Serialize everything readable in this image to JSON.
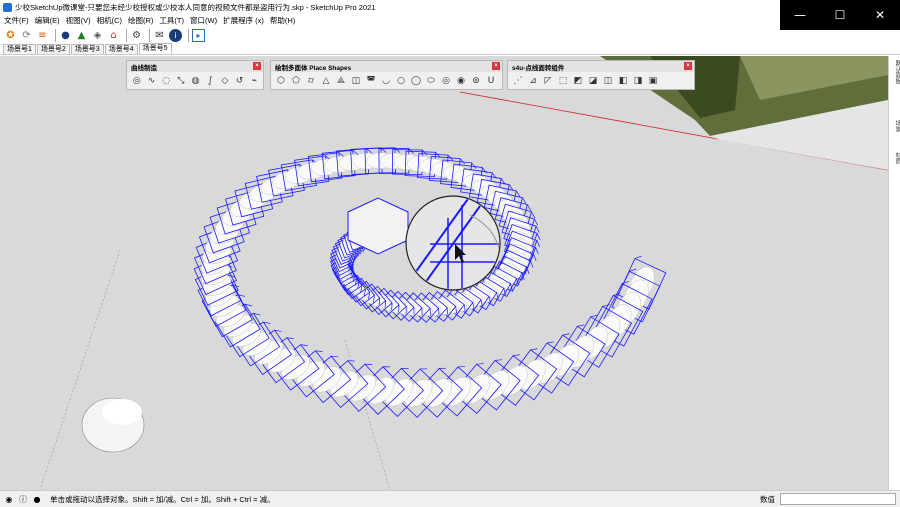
{
  "window": {
    "title": "少校SketchUp微课堂-只要您未经少校授权或少校本人同意的视频文件都是盗用行为.skp - SketchUp Pro 2021",
    "controls": {
      "minimize": "—",
      "maximize": "☐",
      "close": "✕"
    }
  },
  "menu": [
    "文件(F)",
    "编辑(E)",
    "视图(V)",
    "相机(C)",
    "绘图(R)",
    "工具(T)",
    "窗口(W)",
    "扩展程序 (x)",
    "帮助(H)"
  ],
  "toolbar": {
    "icons": [
      "getting-started-icon",
      "refresh-icon",
      "layers-icon",
      "components-icon",
      "tree-icon",
      "materials-icon",
      "warehouse-icon",
      "gear-icon",
      "mail-icon",
      "info-icon",
      "ruby-icon"
    ]
  },
  "scenes": {
    "tabs": [
      "场景号1",
      "场景号2",
      "场景号3",
      "场景号4",
      "场景号5"
    ],
    "active_index": 4
  },
  "panels": {
    "curve": {
      "title": "曲线制造",
      "close": "×"
    },
    "shapes": {
      "title": "绘制多面体 Place Shapes",
      "close": "×"
    },
    "s4u": {
      "title": "s4u-点线面转组件",
      "close": "×"
    }
  },
  "right_tray": [
    "默认面板",
    "场景",
    "材质"
  ],
  "status": {
    "message": "单击或拖动以选择对象。Shift = 加/减。Ctrl = 加。Shift + Ctrl = 减。",
    "measurements_label": "数值",
    "measurements_value": ""
  },
  "colors": {
    "viewport_bg": "#d9d9d9",
    "selection_blue": "#1a1aff",
    "axis_red": "#cc2222"
  }
}
